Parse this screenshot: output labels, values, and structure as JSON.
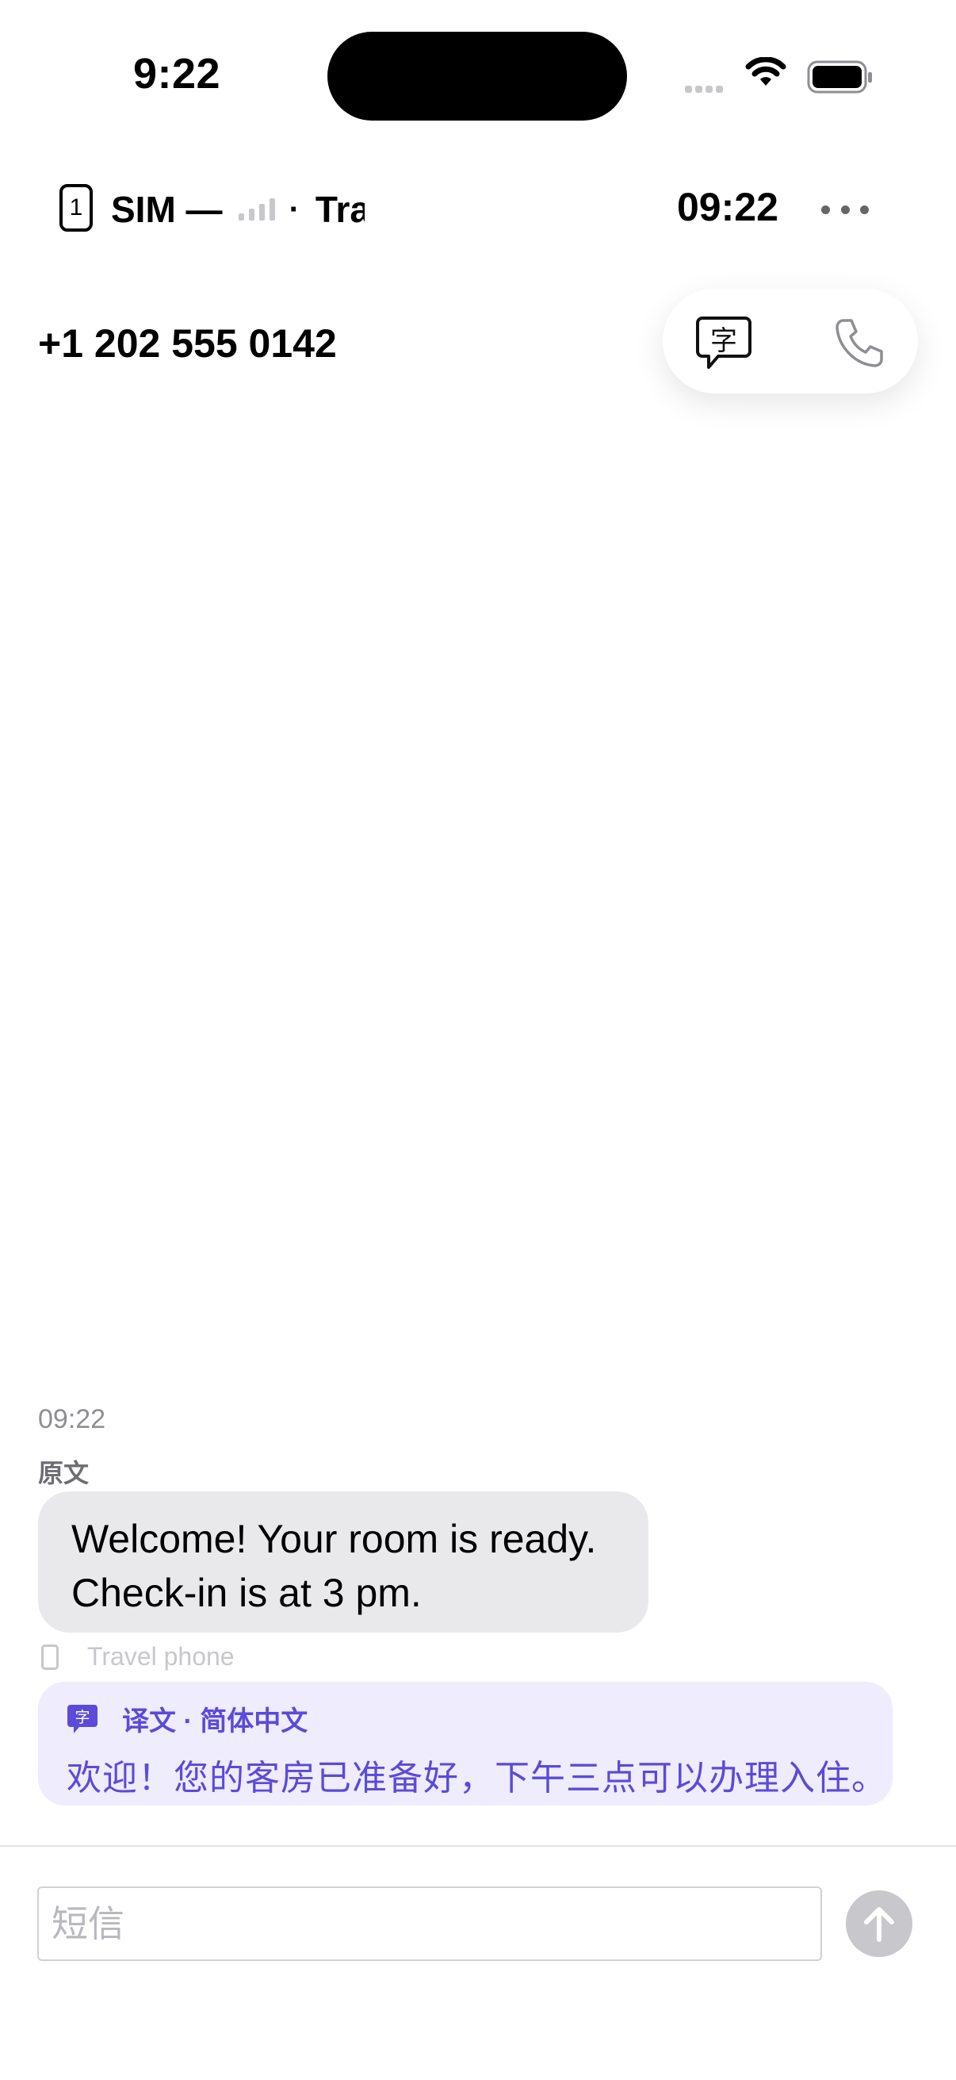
{
  "status_bar": {
    "time": "9:22"
  },
  "header": {
    "sim_slot": "1",
    "sim_label": "SIM —",
    "sim_dot": "·",
    "carrier_truncated": "Tra",
    "time": "09:22",
    "more_icon": "ellipsis-icon"
  },
  "contact": {
    "number": "+1 202 555 0142",
    "translate_icon": "translate-bubble-icon",
    "call_icon": "phone-icon"
  },
  "messages": [
    {
      "time": "09:22",
      "original_label": "原文",
      "text_line1": "Welcome! Your room is ready.",
      "text_line2": "Check-in is at 3 pm.",
      "device_label": "Travel phone",
      "translation": {
        "label": "译文 · 简体中文",
        "text": "欢迎！您的客房已准备好，下午三点可以办理入住。"
      }
    }
  ],
  "compose": {
    "placeholder": "短信",
    "send_icon": "arrow-up-icon"
  },
  "colors": {
    "accent": "#5b4bd8",
    "translation_bg": "#eeecfd",
    "bubble_bg": "#e9e9eb",
    "send_disabled": "#c7c7cc"
  }
}
